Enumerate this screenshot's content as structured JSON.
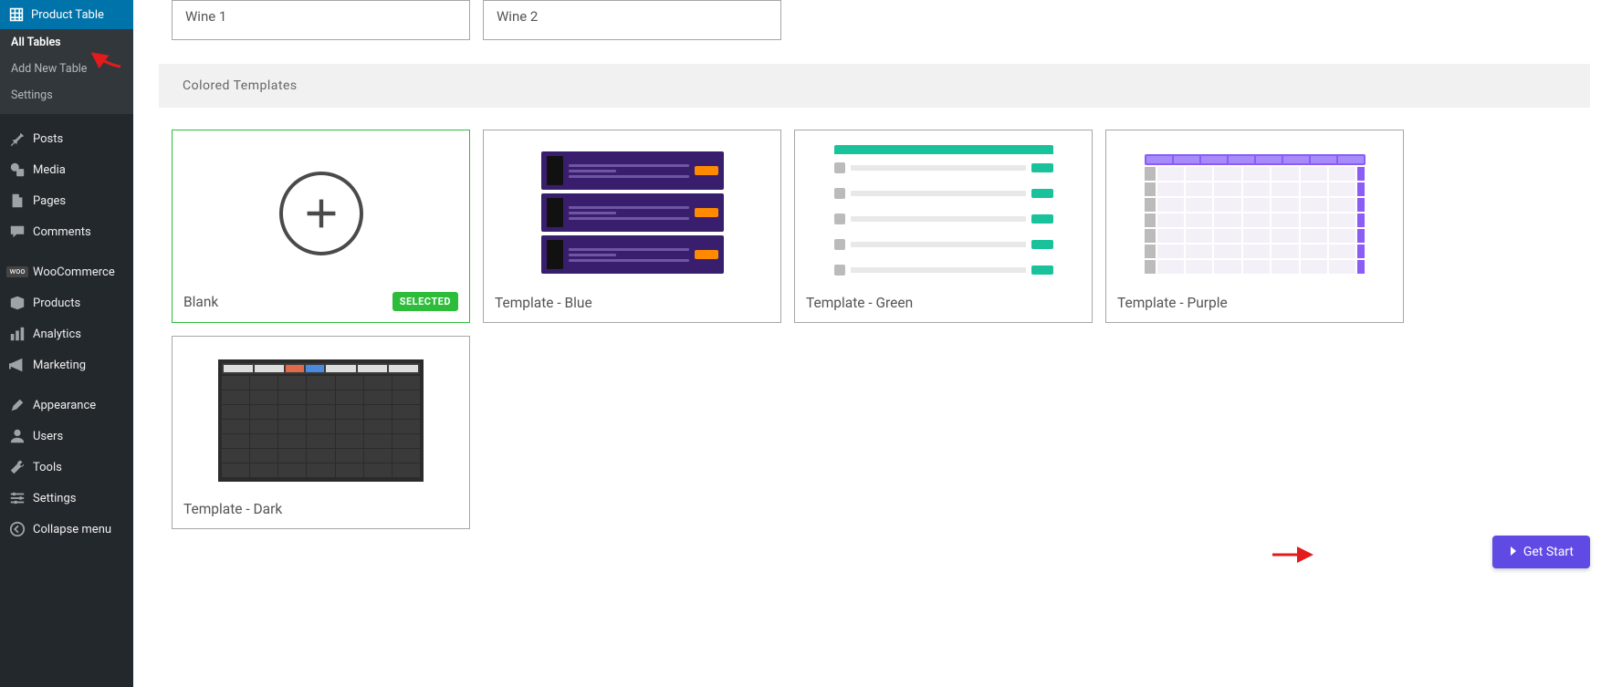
{
  "sidebar": {
    "active": {
      "label": "Product Table"
    },
    "submenu": [
      {
        "label": "All Tables",
        "selected": true
      },
      {
        "label": "Add New Table"
      },
      {
        "label": "Settings"
      }
    ],
    "items": [
      {
        "label": "Posts",
        "icon": "pin-icon"
      },
      {
        "label": "Media",
        "icon": "media-icon"
      },
      {
        "label": "Pages",
        "icon": "page-icon"
      },
      {
        "label": "Comments",
        "icon": "comment-icon"
      },
      {
        "label": "WooCommerce",
        "icon": "woocommerce-icon",
        "badge": "woo"
      },
      {
        "label": "Products",
        "icon": "products-icon"
      },
      {
        "label": "Analytics",
        "icon": "analytics-icon"
      },
      {
        "label": "Marketing",
        "icon": "marketing-icon"
      },
      {
        "label": "Appearance",
        "icon": "appearance-icon"
      },
      {
        "label": "Users",
        "icon": "users-icon"
      },
      {
        "label": "Tools",
        "icon": "tools-icon"
      },
      {
        "label": "Settings",
        "icon": "settings-icon"
      },
      {
        "label": "Collapse menu",
        "icon": "collapse-icon"
      }
    ]
  },
  "top_cards": [
    {
      "label": "Wine 1"
    },
    {
      "label": "Wine 2"
    }
  ],
  "section_title": "Colored Templates",
  "templates": [
    {
      "title": "Blank",
      "selected": true,
      "badge": "SELECTED"
    },
    {
      "title": "Template - Blue",
      "selected": false
    },
    {
      "title": "Template - Green",
      "selected": false
    },
    {
      "title": "Template - Purple",
      "selected": false
    },
    {
      "title": "Template - Dark",
      "selected": false
    }
  ],
  "cta": {
    "label": "Get Start"
  }
}
